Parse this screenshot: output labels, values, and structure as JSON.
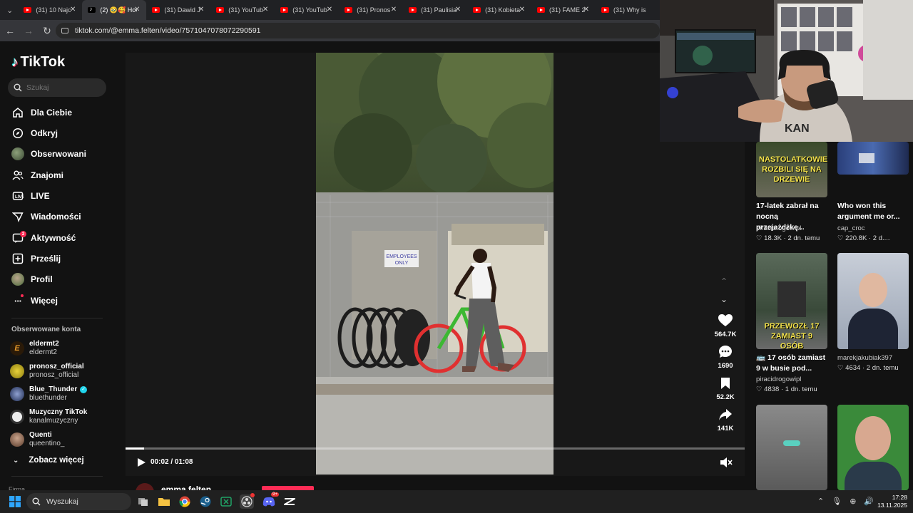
{
  "browser": {
    "tabs": [
      {
        "label": "(31) 10 Najc",
        "icon": "youtube-icon",
        "active": false
      },
      {
        "label": "(2) 🥹🥰 Hov",
        "icon": "tiktok-icon",
        "active": true
      },
      {
        "label": "(31) Dawid J",
        "icon": "youtube-icon",
        "active": false
      },
      {
        "label": "(31) YouTub",
        "icon": "youtube-icon",
        "active": false
      },
      {
        "label": "(31) YouTub",
        "icon": "youtube-icon",
        "active": false
      },
      {
        "label": "(31) Pronos",
        "icon": "youtube-icon",
        "active": false
      },
      {
        "label": "(31) Paulisia",
        "icon": "youtube-icon",
        "active": false
      },
      {
        "label": "(31) Kobieta",
        "icon": "youtube-icon",
        "active": false
      },
      {
        "label": "(31) FAME 2",
        "icon": "youtube-icon",
        "active": false
      },
      {
        "label": "(31) Why is",
        "icon": "youtube-icon",
        "active": false
      }
    ],
    "url": "tiktok.com/@emma.felten/video/7571047078072290591"
  },
  "sidebar": {
    "logo": "TikTok",
    "search_placeholder": "Szukaj",
    "nav": [
      {
        "label": "Dla Ciebie",
        "icon": "home-icon"
      },
      {
        "label": "Odkryj",
        "icon": "compass-icon"
      },
      {
        "label": "Obserwowani",
        "icon": "avatar-icon"
      },
      {
        "label": "Znajomi",
        "icon": "friends-icon"
      },
      {
        "label": "LIVE",
        "icon": "live-icon"
      },
      {
        "label": "Wiadomości",
        "icon": "messages-icon"
      },
      {
        "label": "Aktywność",
        "icon": "activity-icon",
        "badge": "2"
      },
      {
        "label": "Prześlij",
        "icon": "upload-icon"
      },
      {
        "label": "Profil",
        "icon": "profile-icon"
      },
      {
        "label": "Więcej",
        "icon": "more-icon"
      }
    ],
    "followed_title": "Obserwowane konta",
    "accounts": [
      {
        "display": "eldermt2",
        "handle": "eldermt2",
        "color": "#3a2410",
        "verified": false
      },
      {
        "display": "pronosz_official",
        "handle": "pronosz_official",
        "color": "#b8a01c",
        "verified": false
      },
      {
        "display": "Blue_Thunder",
        "handle": "bluethunder",
        "color": "#2b3b6b",
        "verified": true
      },
      {
        "display": "Muzyczny TikTok",
        "handle": "kanalmuzyczny",
        "color": "#e8e8e8",
        "verified": false
      },
      {
        "display": "Quenti",
        "handle": "queentino_",
        "color": "#7a5a4a",
        "verified": false
      }
    ],
    "see_more": "Zobacz więcej",
    "footer": "Firma"
  },
  "player": {
    "current_time": "00:02",
    "total_time": "01:08",
    "time_display": "00:02 / 01:08",
    "progress": 0.03,
    "author": "emma.felten",
    "actions": [
      {
        "icon": "heart-icon",
        "count": "564.7K"
      },
      {
        "icon": "comment-icon",
        "count": "1690"
      },
      {
        "icon": "bookmark-icon",
        "count": "52.2K"
      },
      {
        "icon": "share-icon",
        "count": "141K"
      }
    ],
    "sign_text_1": "EMPLOYEES",
    "sign_text_2": "ONLY"
  },
  "recommendations": [
    {
      "title": "17-latek zabrał na nocną przejażdżkę...",
      "author": "piracidrogowipl",
      "likes": "18.3K",
      "age": "2 dn. temu",
      "overlay": "NASTOLATKOWIE ROZBILI SIĘ NA DRZEWIE"
    },
    {
      "title": "Who won this argument me or...",
      "author": "cap_croc",
      "likes": "220.8K",
      "age": "2 d....",
      "overlay": ""
    },
    {
      "title": "🚌 17 osób zamiast 9 w busie pod...",
      "author": "piracidrogowipl",
      "likes": "4838",
      "age": "1 dn. temu",
      "overlay": "PRZEWOZŁ 17 ZAMIAST 9 OSÓB"
    },
    {
      "title": "",
      "author": "marekjakubiak397",
      "likes": "4634",
      "age": "2 dn. temu",
      "overlay": ""
    }
  ],
  "taskbar": {
    "search_placeholder": "Wyszukaj",
    "time": "17:28",
    "date": "13.11.2025",
    "discord_badge": "9+"
  },
  "colors": {
    "accent": "#fe2c55",
    "background": "#121212",
    "verified": "#20d5ec"
  }
}
